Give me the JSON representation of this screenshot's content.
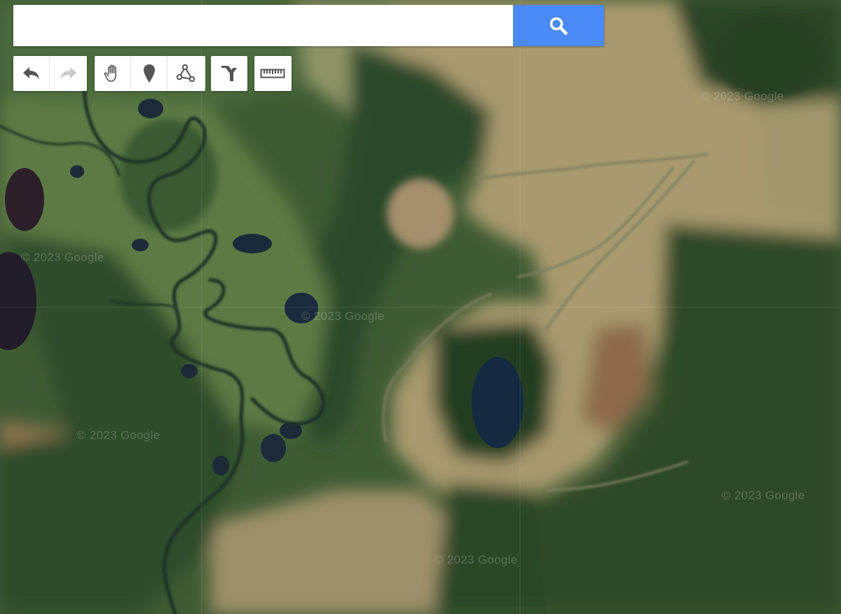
{
  "search": {
    "value": "",
    "placeholder": "",
    "button_icon": "search-icon"
  },
  "toolbar": {
    "history": [
      "undo-icon",
      "redo-icon"
    ],
    "tools": [
      "pan-hand-icon",
      "marker-pin-icon",
      "polyline-icon"
    ],
    "route": [
      "route-fork-icon"
    ],
    "measure": [
      "ruler-icon"
    ]
  },
  "map": {
    "type": "satellite",
    "watermarks": [
      "© 2023 Google",
      "© 2023 Google",
      "© 2023 Google",
      "© 2023 Google",
      "© 2023 Google",
      "© 2023 Google"
    ]
  },
  "colors": {
    "search_button": "#4a8af4",
    "forest": "#2f4a2a",
    "meadow": "#a89f6f",
    "water": "#1a2f45"
  }
}
